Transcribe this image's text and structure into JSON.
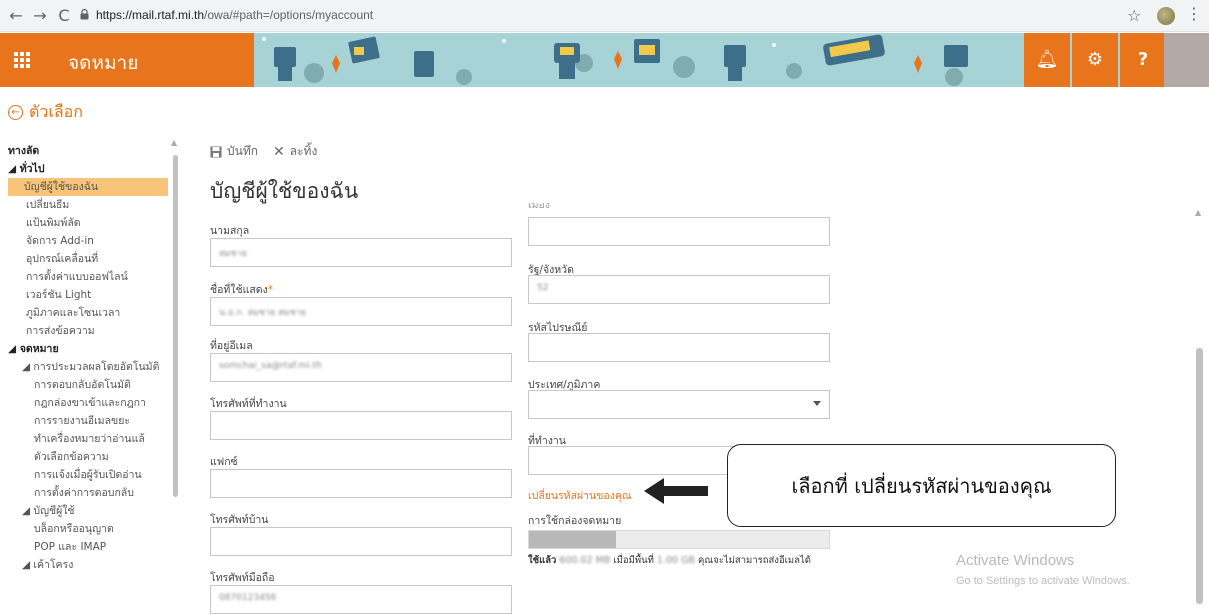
{
  "browser": {
    "url_host": "https://mail.rtaf.mi.th",
    "url_path": "/owa/#path=/options/myaccount"
  },
  "app": {
    "title": "จดหมาย"
  },
  "options": {
    "back_label": "ตัวเลือก"
  },
  "sidebar": {
    "items": [
      {
        "label": "ทางลัด",
        "indent": 0,
        "bold": true
      },
      {
        "label": "◢ ทั่วไป",
        "indent": 0,
        "bold": true
      },
      {
        "label": "บัญชีผู้ใช้ของฉัน",
        "indent": 1,
        "selected": true
      },
      {
        "label": "เปลี่ยนธีม",
        "indent": 1
      },
      {
        "label": "แป้นพิมพ์ลัด",
        "indent": 1
      },
      {
        "label": "จัดการ Add-in",
        "indent": 1
      },
      {
        "label": "อุปกรณ์เคลื่อนที่",
        "indent": 1
      },
      {
        "label": "การตั้งค่าแบบออฟไลน์",
        "indent": 1
      },
      {
        "label": "เวอร์ชัน Light",
        "indent": 1
      },
      {
        "label": "ภูมิภาคและโซนเวลา",
        "indent": 1
      },
      {
        "label": "การส่งข้อความ",
        "indent": 1
      },
      {
        "label": "◢ จดหมาย",
        "indent": 0,
        "bold": true
      },
      {
        "label": "◢ การประมวลผลโดยอัตโนมัติ",
        "indent": 1
      },
      {
        "label": "การตอบกลับอัตโนมัติ",
        "indent": 2
      },
      {
        "label": "กฎกล่องขาเข้าและกฎกา",
        "indent": 2
      },
      {
        "label": "การรายงานอีเมลขยะ",
        "indent": 2
      },
      {
        "label": "ทำเครื่องหมายว่าอ่านแล้",
        "indent": 2
      },
      {
        "label": "ตัวเลือกข้อความ",
        "indent": 2
      },
      {
        "label": "การแจ้งเมื่อผู้รับเปิดอ่าน",
        "indent": 2
      },
      {
        "label": "การตั้งค่าการตอบกลับ",
        "indent": 2
      },
      {
        "label": "◢ บัญชีผู้ใช้",
        "indent": 1
      },
      {
        "label": "บล็อกหรืออนุญาต",
        "indent": 2
      },
      {
        "label": "POP และ IMAP",
        "indent": 2
      },
      {
        "label": "◢ เค้าโครง",
        "indent": 1
      }
    ]
  },
  "toolbar": {
    "save_label": "บันทึก",
    "discard_label": "ละทิ้ง"
  },
  "page": {
    "title": "บัญชีผู้ใช้ของฉัน"
  },
  "form": {
    "left": [
      {
        "label": "นามสกุล",
        "value": "สมชาย",
        "required": false
      },
      {
        "label": "ชื่อที่ใช้แสดง",
        "value": "น.อ.ก. สมชาย สมชาย",
        "required": true
      },
      {
        "label": "ที่อยู่อีเมล",
        "value": "somchai_sa@rtaf.mi.th",
        "required": false
      },
      {
        "label": "โทรศัพท์ที่ทำงาน",
        "value": "",
        "required": false
      },
      {
        "label": "แฟกซ์",
        "value": "",
        "required": false
      },
      {
        "label": "โทรศัพท์บ้าน",
        "value": "",
        "required": false
      },
      {
        "label": "โทรศัพท์มือถือ",
        "value": "0870123456",
        "required": false
      }
    ],
    "right": [
      {
        "label": "เมือง",
        "value": ""
      },
      {
        "label": "รัฐ/จังหวัด",
        "value": "52"
      },
      {
        "label": "รหัสไปรษณีย์",
        "value": ""
      },
      {
        "label": "ประเทศ/ภูมิภาค",
        "value": "",
        "dropdown": true
      },
      {
        "label": "ที่ทำงาน",
        "value": ""
      }
    ],
    "required_mark": "*",
    "change_password_link": "เปลี่ยนรหัสผ่านของคุณ",
    "mailbox_usage_label": "การใช้กล่องจดหมาย",
    "usage_used_prefix": "ใช้แล้ว",
    "usage_used_value": "600.02 MB",
    "usage_when_prefix": "เมื่อมีพื้นที่",
    "usage_when_value": "1.00 GB",
    "usage_suffix": "คุณจะไม่สามารถส่งอีเมลได้",
    "quota_fraction": 0.29
  },
  "annotation": {
    "callout_text": "เลือกที่ เปลี่ยนรหัสผ่านของคุณ"
  },
  "watermark": {
    "line1": "Activate Windows",
    "line2": "Go to Settings to activate Windows."
  },
  "colors": {
    "accent": "#e8741b",
    "header_bg": "#a7d3d6",
    "selected": "#f8c47a"
  }
}
